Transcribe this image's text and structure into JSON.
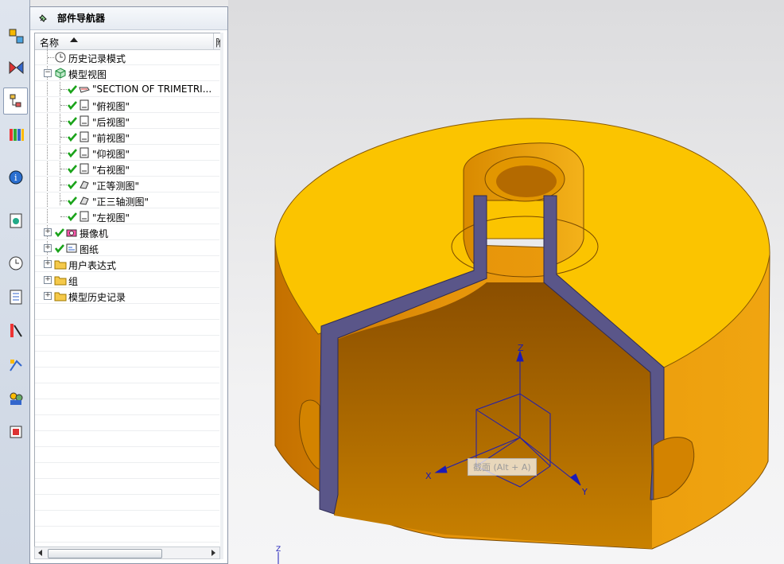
{
  "navigator": {
    "title": "部件导航器",
    "column_name": "名称",
    "column_extra": "附"
  },
  "tree": [
    {
      "label": "历史记录模式",
      "icon": "clock-icon",
      "level": 0,
      "check": false,
      "expander": ""
    },
    {
      "label": "模型视图",
      "icon": "model-views-icon",
      "level": 0,
      "check": false,
      "expander": "−"
    },
    {
      "label": "\"SECTION OF TRIMETRI...",
      "icon": "section-view-icon",
      "level": 1,
      "check": true,
      "expander": ""
    },
    {
      "label": "\"俯视图\"",
      "icon": "view-icon",
      "level": 1,
      "check": true,
      "expander": ""
    },
    {
      "label": "\"后视图\"",
      "icon": "view-icon",
      "level": 1,
      "check": true,
      "expander": ""
    },
    {
      "label": "\"前视图\"",
      "icon": "view-icon",
      "level": 1,
      "check": true,
      "expander": ""
    },
    {
      "label": "\"仰视图\"",
      "icon": "view-icon",
      "level": 1,
      "check": true,
      "expander": ""
    },
    {
      "label": "\"右视图\"",
      "icon": "view-icon",
      "level": 1,
      "check": true,
      "expander": ""
    },
    {
      "label": "\"正等测图\"",
      "icon": "iso-view-icon",
      "level": 1,
      "check": true,
      "expander": ""
    },
    {
      "label": "\"正三轴测图\"",
      "icon": "iso-view-icon",
      "level": 1,
      "check": true,
      "expander": ""
    },
    {
      "label": "\"左视图\"",
      "icon": "view-icon",
      "level": 1,
      "check": true,
      "expander": ""
    },
    {
      "label": "摄像机",
      "icon": "camera-icon",
      "level": 0,
      "check": true,
      "expander": "+"
    },
    {
      "label": "图纸",
      "icon": "drawing-icon",
      "level": 0,
      "check": true,
      "expander": "+"
    },
    {
      "label": "用户表达式",
      "icon": "folder-icon",
      "level": 0,
      "check": false,
      "expander": "+"
    },
    {
      "label": "组",
      "icon": "folder-icon",
      "level": 0,
      "check": false,
      "expander": "+"
    },
    {
      "label": "模型历史记录",
      "icon": "folder-icon",
      "level": 0,
      "check": false,
      "expander": "+"
    }
  ],
  "toolbar_icons": [
    "assembly-navigator-icon",
    "constraint-navigator-icon",
    "part-navigator-icon",
    "reuse-library-icon",
    "info-icon",
    "web-browser-icon",
    "history-icon",
    "process-navigator-icon",
    "color-palette-icon",
    "system-materials-icon",
    "roles-icon",
    "visualization-icon"
  ],
  "axes": {
    "z": "Z",
    "x": "X",
    "y": "Y",
    "z_small": "Z"
  },
  "tooltip": "截面 (Alt + A)",
  "colors": {
    "part_face": "#f5b400",
    "part_side": "#e89a00",
    "section_cut": "#5a5689",
    "triad": "#1a1ab8",
    "check": "#1aa31a"
  }
}
